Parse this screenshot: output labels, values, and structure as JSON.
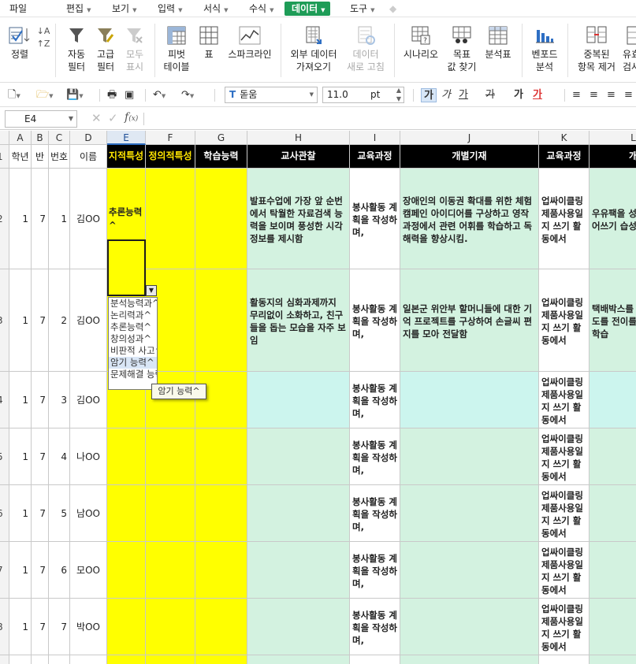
{
  "menu": {
    "file": "파일",
    "items": [
      "편집",
      "보기",
      "입력",
      "서식",
      "수식",
      "데이터",
      "도구"
    ]
  },
  "ribbon": {
    "buttons": [
      {
        "label": "정렬",
        "icon": "sort-icon"
      },
      {
        "label": "자동\n필터",
        "icon": "auto-filter-icon"
      },
      {
        "label": "고급\n필터",
        "icon": "advanced-filter-icon"
      },
      {
        "label": "모두\n표시",
        "icon": "show-all-icon",
        "disabled": true
      },
      {
        "label": "피벗\n테이블",
        "icon": "pivot-table-icon"
      },
      {
        "label": "표",
        "icon": "table-icon"
      },
      {
        "label": "스파크라인",
        "icon": "sparkline-icon"
      },
      {
        "label": "외부 데이터\n가져오기",
        "icon": "external-data-icon"
      },
      {
        "label": "데이터\n새로 고침",
        "icon": "refresh-icon",
        "disabled": true
      },
      {
        "label": "시나리오",
        "icon": "scenario-icon"
      },
      {
        "label": "목표\n값 찾기",
        "icon": "goal-seek-icon"
      },
      {
        "label": "분석표",
        "icon": "data-table-icon"
      },
      {
        "label": "벤포드\n분석",
        "icon": "benford-icon"
      },
      {
        "label": "중복된\n항목 제거",
        "icon": "remove-duplicates-icon"
      },
      {
        "label": "유효\n검사",
        "icon": "validation-icon"
      }
    ]
  },
  "format": {
    "font": "돋움",
    "size": "11.0",
    "unit": "pt",
    "bold": "가",
    "italic": "가",
    "underline": "가",
    "strike": "가",
    "shadow": "가",
    "color": "가"
  },
  "name_box": "E4",
  "formula_fx": "f",
  "columns": [
    "A",
    "B",
    "C",
    "D",
    "E",
    "F",
    "G",
    "H",
    "I",
    "J",
    "K",
    "L"
  ],
  "header": {
    "a": "학년",
    "b": "반",
    "c": "번호",
    "d": "이름",
    "e": "지적특성",
    "f": "정의적특성",
    "g": "학습능력",
    "h": "교사관찰",
    "i": "교육과정",
    "j": "개별기재",
    "k": "교육과정",
    "l": "개"
  },
  "row_numbers": [
    "1",
    "2",
    "3",
    "4",
    "5",
    "6",
    "7",
    "8",
    "9"
  ],
  "rows": [
    {
      "grade": "1",
      "class": "7",
      "no": "1",
      "name": "김OO",
      "trait": "추론능력^",
      "obs": "발표수업에 가장 앞 순번에서 탁월한 자료검색 능력을 보이며 풍성한 시각 정보를 제시함",
      "cur": "봉사활동 계획을 작성하며,",
      "ind": "장애인의 이동권 확대를 위한 체험 캠페인 아이디어를 구상하고 영작 과정에서 관련 어휘를 학습하고 독해력을 향상시킴.",
      "cur2": "업싸이클링 제품사용일지 쓰기 활동에서",
      "l": "우유팩을 성장관찰일어쓰기 습성실히 관"
    },
    {
      "grade": "1",
      "class": "7",
      "no": "2",
      "name": "김OO",
      "trait": "창의성과^",
      "obs": "활동지의 심화과제까지 무리없이 소화하고, 친구들을 돕는 모습을 자주 보임",
      "cur": "봉사활동 계획을 작성하며,",
      "ind": "일본군 위안부 할머니들에 대한 기억 프로젝트를 구상하여 손글씨 편지를 모아 전달함",
      "cur2": "업싸이클링 제품사용일지 쓰기 활동에서",
      "l": "택배박스를 방한용온도를 전이를 통해휘를 학습"
    },
    {
      "grade": "1",
      "class": "7",
      "no": "3",
      "name": "김OO",
      "trait": "",
      "obs": "",
      "cur": "봉사활동 계획을 작성하며,",
      "ind": "",
      "cur2": "업싸이클링 제품사용일지 쓰기 활동에서",
      "l": ""
    },
    {
      "grade": "1",
      "class": "7",
      "no": "4",
      "name": "나OO",
      "trait": "",
      "obs": "",
      "cur": "봉사활동 계획을 작성하며,",
      "ind": "",
      "cur2": "업싸이클링 제품사용일지 쓰기 활동에서",
      "l": ""
    },
    {
      "grade": "1",
      "class": "7",
      "no": "5",
      "name": "남OO",
      "trait": "",
      "obs": "",
      "cur": "봉사활동 계획을 작성하며,",
      "ind": "",
      "cur2": "업싸이클링 제품사용일지 쓰기 활동에서",
      "l": ""
    },
    {
      "grade": "1",
      "class": "7",
      "no": "6",
      "name": "모OO",
      "trait": "",
      "obs": "",
      "cur": "봉사활동 계획을 작성하며,",
      "ind": "",
      "cur2": "업싸이클링 제품사용일지 쓰기 활동에서",
      "l": ""
    },
    {
      "grade": "1",
      "class": "7",
      "no": "7",
      "name": "박OO",
      "trait": "",
      "obs": "",
      "cur": "봉사활동 계획을 작성하며,",
      "ind": "",
      "cur2": "업싸이클링 제품사용일지 쓰기 활동에서",
      "l": ""
    },
    {
      "grade": "1",
      "class": "7",
      "no": "8",
      "name": "박OO",
      "trait": "",
      "obs": "",
      "cur": "",
      "ind": "",
      "cur2": "",
      "l": ""
    }
  ],
  "dropdown": {
    "options": [
      "분석능력과^",
      "논리력과^",
      "추론능력^",
      "창의성과^",
      "비판적 사고^",
      "암기 능력^",
      "문제해결 능력^"
    ],
    "highlighted_index": 5,
    "tooltip": "암기 능력^"
  },
  "colors": {
    "header_bg": "#000000",
    "header_yellow_text": "#ffe600",
    "yellow_fill": "#ffff00",
    "green_fill": "#d3f2e0",
    "accent": "#1e9c57"
  }
}
